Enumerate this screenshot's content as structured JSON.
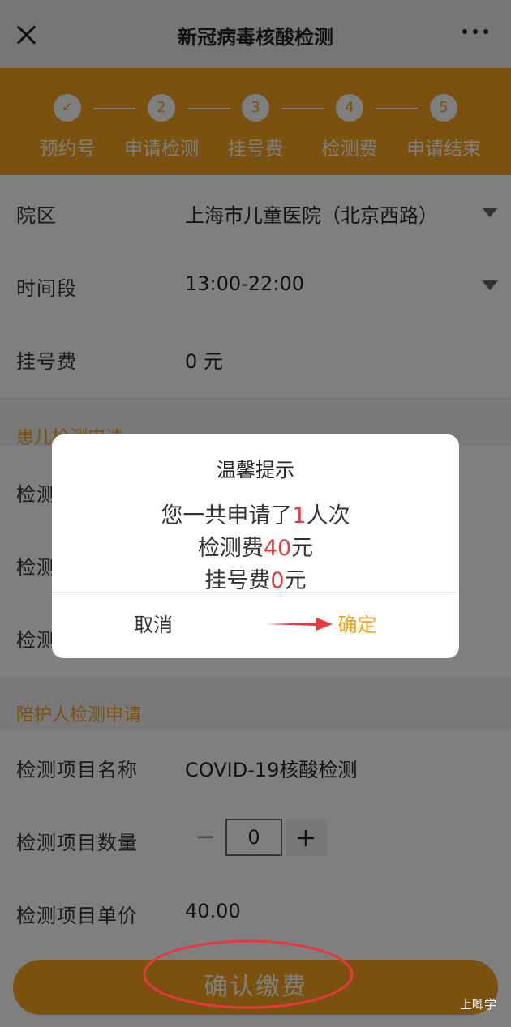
{
  "header": {
    "title": "新冠病毒核酸检测",
    "close_icon": "close-icon",
    "more_icon": "more-icon"
  },
  "steps": [
    {
      "marker": "✓",
      "label": "预约号"
    },
    {
      "marker": "2",
      "label": "申请检测"
    },
    {
      "marker": "3",
      "label": "挂号费"
    },
    {
      "marker": "4",
      "label": "检测费"
    },
    {
      "marker": "5",
      "label": "申请结束"
    }
  ],
  "form": {
    "hospital": {
      "label": "院区",
      "value": "上海市儿童医院（北京西路）"
    },
    "timeslot": {
      "label": "时间段",
      "value": "13:00-22:00"
    },
    "reg_fee": {
      "label": "挂号费",
      "value": "0 元"
    }
  },
  "child_section": {
    "title": "患儿检测申请",
    "rows": [
      "检测项目名称",
      "检测项目数量",
      "检测项目单价"
    ]
  },
  "companion_section": {
    "title": "陪护人检测申请",
    "item_name": {
      "label": "检测项目名称",
      "value": "COVID-19核酸检测"
    },
    "item_qty": {
      "label": "检测项目数量",
      "minus": "−",
      "value": "0",
      "plus": "+"
    },
    "item_price": {
      "label": "检测项目单价",
      "value": "40.00"
    }
  },
  "pay_button": "确认缴费",
  "watermark": "上唧学",
  "dialog": {
    "title": "温馨提示",
    "line1": {
      "prefix": "您一共申请了",
      "num": "1",
      "suffix": "人次"
    },
    "line2": {
      "prefix": "检测费",
      "num": "40",
      "suffix": "元"
    },
    "line3": {
      "prefix": "挂号费",
      "num": "0",
      "suffix": "元"
    },
    "cancel": "取消",
    "confirm": "确定"
  },
  "colors": {
    "accent": "#f4a21e",
    "highlight": "#e8383d"
  }
}
